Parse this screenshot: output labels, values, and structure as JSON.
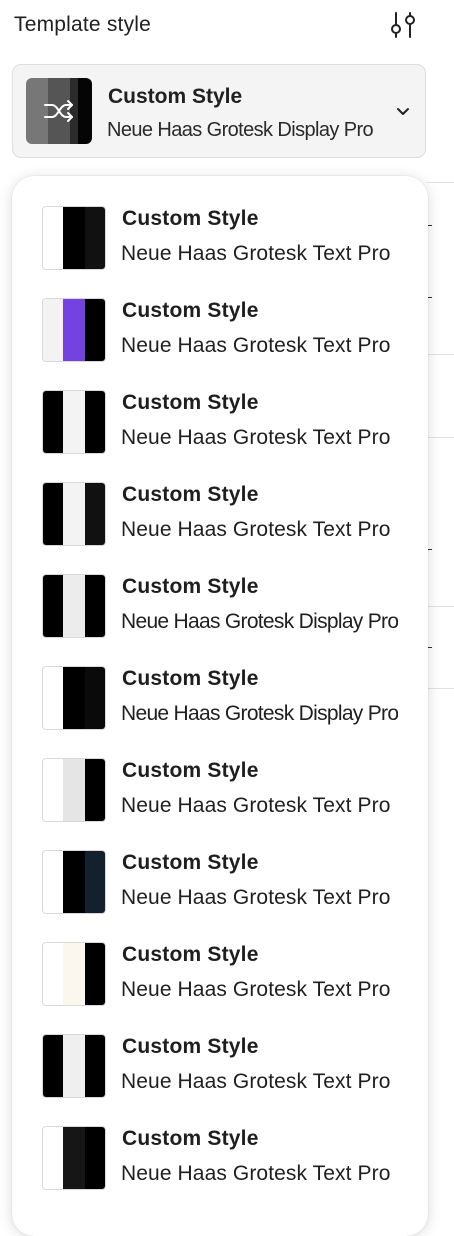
{
  "header": {
    "title": "Template style",
    "settings_icon": "sliders-icon"
  },
  "selected": {
    "title": "Custom Style",
    "font": "Neue Haas Grotesk Display Pro",
    "swatches": [
      "#777777",
      "#555555",
      "#2b2b2b",
      "#050505"
    ],
    "icon": "shuffle-icon",
    "chevron_icon": "chevron-down-icon"
  },
  "options": [
    {
      "title": "Custom Style",
      "font": "Neue Haas Grotesk Text Pro",
      "font_kind": "text",
      "swatches": [
        "#ffffff",
        "#000000",
        "#111111"
      ]
    },
    {
      "title": "Custom Style",
      "font": "Neue Haas Grotesk Text Pro",
      "font_kind": "text",
      "swatches": [
        "#f3f3f3",
        "#7542e2",
        "#000000"
      ]
    },
    {
      "title": "Custom Style",
      "font": "Neue Haas Grotesk Text Pro",
      "font_kind": "text",
      "swatches": [
        "#000000",
        "#f3f3f3",
        "#000000"
      ]
    },
    {
      "title": "Custom Style",
      "font": "Neue Haas Grotesk Text Pro",
      "font_kind": "text",
      "swatches": [
        "#000000",
        "#f3f3f3",
        "#111111"
      ]
    },
    {
      "title": "Custom Style",
      "font": "Neue Haas Grotesk Display Pro",
      "font_kind": "display",
      "swatches": [
        "#000000",
        "#ececec",
        "#000000"
      ]
    },
    {
      "title": "Custom Style",
      "font": "Neue Haas Grotesk Display Pro",
      "font_kind": "display",
      "swatches": [
        "#ffffff",
        "#000000",
        "#0a0a0a"
      ]
    },
    {
      "title": "Custom Style",
      "font": "Neue Haas Grotesk Text Pro",
      "font_kind": "text",
      "swatches": [
        "#ffffff",
        "#e5e5e5",
        "#000000"
      ]
    },
    {
      "title": "Custom Style",
      "font": "Neue Haas Grotesk Text Pro",
      "font_kind": "text",
      "swatches": [
        "#ffffff",
        "#000000",
        "#15202f"
      ]
    },
    {
      "title": "Custom Style",
      "font": "Neue Haas Grotesk Text Pro",
      "font_kind": "text",
      "swatches": [
        "#ffffff",
        "#fbf7ee",
        "#000000"
      ]
    },
    {
      "title": "Custom Style",
      "font": "Neue Haas Grotesk Text Pro",
      "font_kind": "text",
      "swatches": [
        "#000000",
        "#efefef",
        "#000000"
      ]
    },
    {
      "title": "Custom Style",
      "font": "Neue Haas Grotesk Text Pro",
      "font_kind": "text",
      "swatches": [
        "#ffffff",
        "#161616",
        "#000000"
      ]
    }
  ]
}
